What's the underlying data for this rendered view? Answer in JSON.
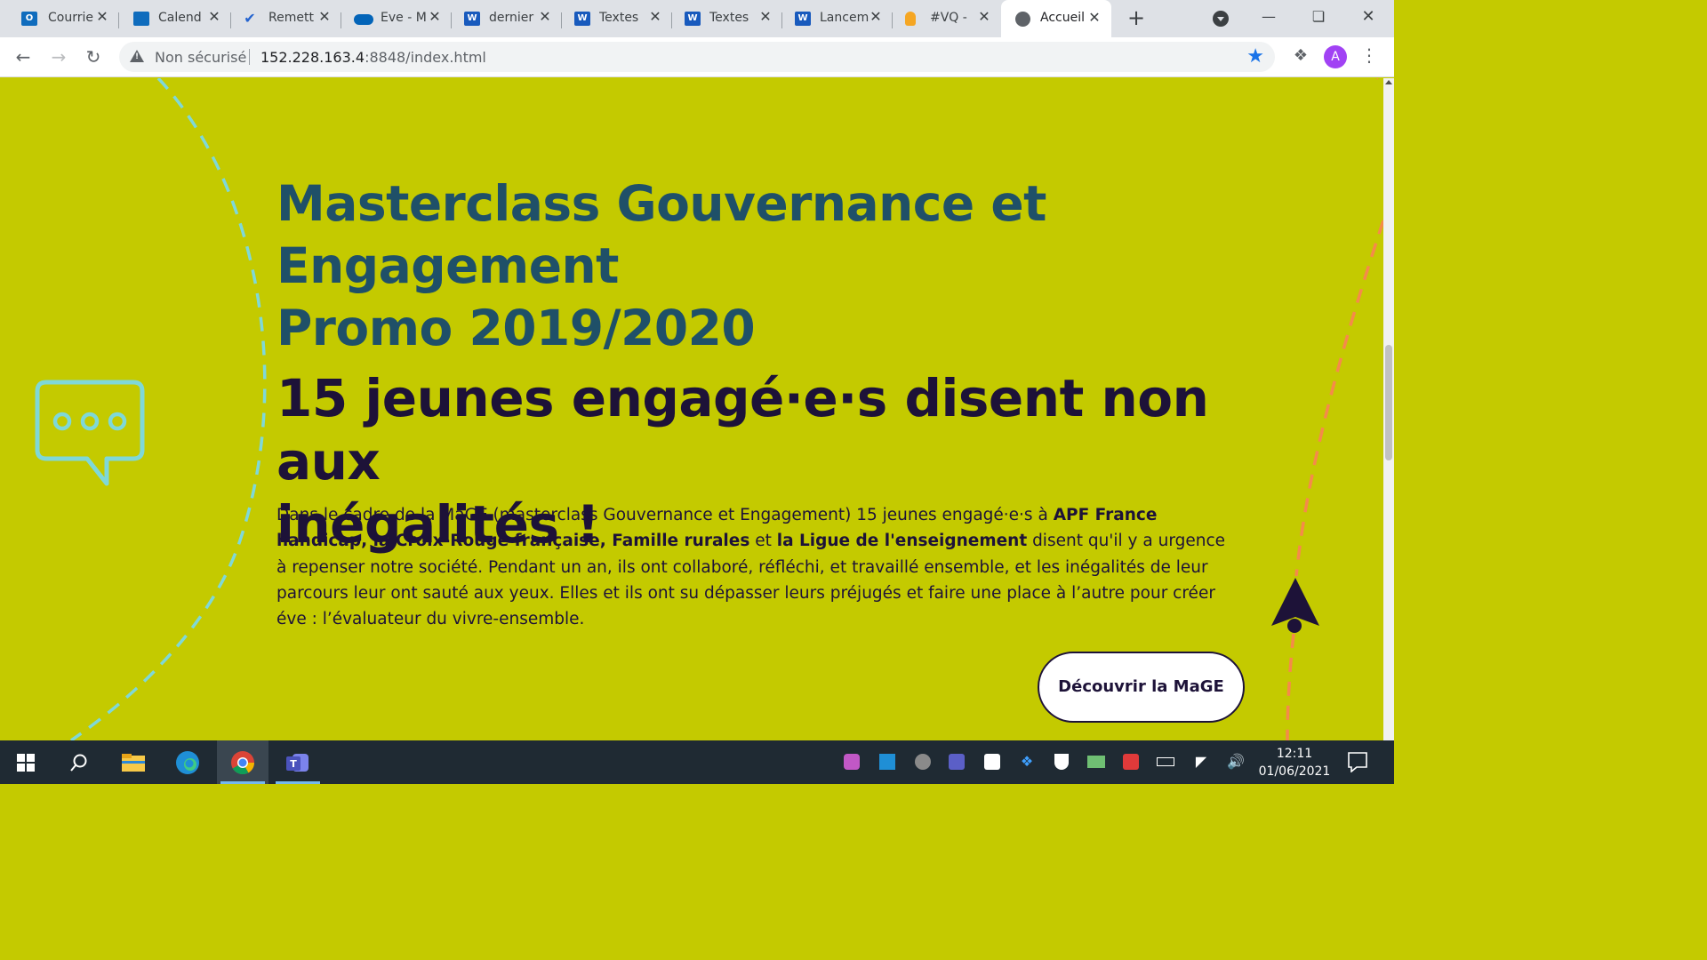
{
  "browser": {
    "tabs": [
      {
        "label": "Courrie",
        "favicon": "outlook-icon",
        "color": "#0f6cbd",
        "letter": "O"
      },
      {
        "label": "Calend",
        "favicon": "calendar-icon",
        "color": "#0f6cbd",
        "letter": ""
      },
      {
        "label": "Remett",
        "favicon": "todo-icon",
        "color": "#2564cf",
        "letter": "✔"
      },
      {
        "label": "Eve - M",
        "favicon": "onedrive-icon",
        "color": "#0364b8",
        "letter": ""
      },
      {
        "label": "dernier",
        "favicon": "word-icon",
        "color": "#185abd",
        "letter": "W"
      },
      {
        "label": "Textes",
        "favicon": "word-icon",
        "color": "#185abd",
        "letter": "W"
      },
      {
        "label": "Textes",
        "favicon": "word-icon",
        "color": "#185abd",
        "letter": "W"
      },
      {
        "label": "Lancem",
        "favicon": "word-icon",
        "color": "#185abd",
        "letter": "W"
      },
      {
        "label": "#VQ - ",
        "favicon": "flame-icon",
        "color": "#f5a623",
        "letter": ""
      },
      {
        "label": "Accueil",
        "favicon": "globe-icon",
        "color": "#5f6368",
        "letter": "",
        "active": true
      }
    ],
    "address": {
      "security_label": "Non sécurisé",
      "url_host": "152.228.163.4",
      "url_rest": ":8848/index.html"
    },
    "profile_initial": "A"
  },
  "page": {
    "title_line1": "Masterclass Gouvernance et",
    "title_line2": "Engagement",
    "title_line3": "Promo 2019/2020",
    "headline_line1": "15 jeunes engagé·e·s disent non aux",
    "headline_line2": "inégalités !",
    "body": {
      "t1": "Dans le cadre de la MaGE (masterclass Gouvernance et Engagement) 15 jeunes engagé·e·s à ",
      "b1": "APF France handicap, la Croix-Rouge française, Famille rurales",
      "t2": " et ",
      "b2": "la Ligue de l'enseignement",
      "t3": " disent qu'il y a urgence à repenser notre société. Pendant un an, ils ont collaboré, réfléchi, et travaillé ensemble, et les inégalités de leur parcours leur ont sauté aux yeux. Elles et ils ont su dépasser leurs préjugés et faire une place à l’autre pour créer éve : l’évaluateur du vivre-ensemble."
    },
    "cta_label": "Découvrir la MaGE",
    "colors": {
      "background": "#c4ca00",
      "title": "#1f5068",
      "headline": "#1d1238",
      "accent_cyan": "#7fd8d8",
      "accent_orange": "#f58a4a"
    }
  },
  "taskbar": {
    "time": "12:11",
    "date": "01/06/2021",
    "apps": [
      "windows-start-icon",
      "search-icon",
      "file-explorer-icon",
      "edge-icon",
      "chrome-icon",
      "teams-icon"
    ]
  }
}
